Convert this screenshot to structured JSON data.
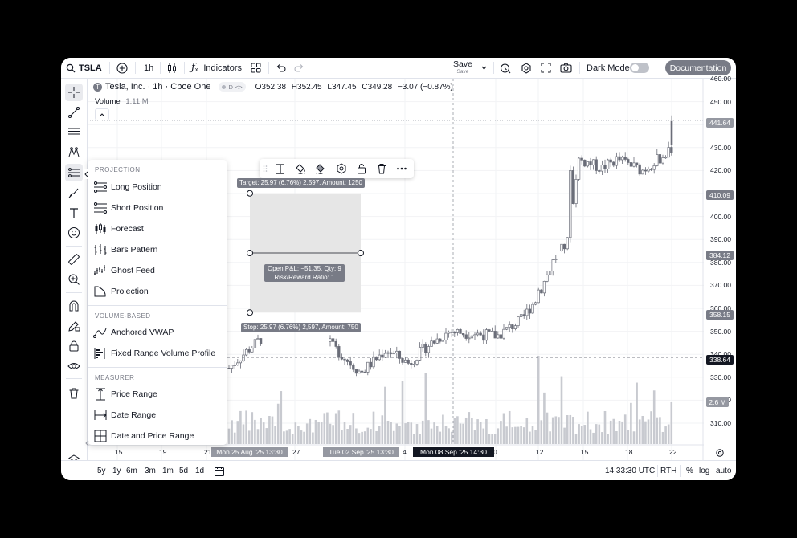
{
  "toolbar": {
    "symbol": "TSLA",
    "interval": "1h",
    "indicators_label": "Indicators",
    "save_label": "Save",
    "save_sub": "Save",
    "dark_mode_label": "Dark Mode",
    "dark_mode_on": false,
    "documentation_label": "Documentation"
  },
  "legend": {
    "title": "Tesla, Inc. · 1h · Cboe One",
    "badge": "D",
    "open_label": "O",
    "open": "352.38",
    "high_label": "H",
    "high": "352.45",
    "low_label": "L",
    "low": "347.45",
    "close_label": "C",
    "close": "349.28",
    "change": "−3.07 (−0.87%)",
    "volume_label": "Volume",
    "volume": "1.11 M"
  },
  "flyout": {
    "sections": [
      {
        "title": "PROJECTION",
        "items": [
          "Long Position",
          "Short Position",
          "Forecast",
          "Bars Pattern",
          "Ghost Feed",
          "Projection"
        ]
      },
      {
        "title": "VOLUME-BASED",
        "items": [
          "Anchored VWAP",
          "Fixed Range Volume Profile"
        ]
      },
      {
        "title": "MEASURER",
        "items": [
          "Price Range",
          "Date Range",
          "Date and Price Range"
        ]
      }
    ]
  },
  "position": {
    "target_label": "Target: 25.97 (6.76%) 2,597, Amount: 1250",
    "stop_label": "Stop: 25.97 (6.76%) 2,597, Amount: 750",
    "pnl_label": "Open P&L: −51.35, Qty: 9",
    "rr_label": "Risk/Reward Ratio: 1",
    "entry": 384.12,
    "target": 410.09,
    "stop": 358.15
  },
  "price_axis": {
    "ticks": [
      "460.00",
      "450.00",
      "440.00",
      "430.00",
      "420.00",
      "410.00",
      "400.00",
      "390.00",
      "380.00",
      "370.00",
      "360.00",
      "350.00",
      "340.00",
      "330.00",
      "320.00",
      "310.00"
    ],
    "labels": {
      "crosshair": "441.64",
      "target": "410.09",
      "entry": "384.12",
      "stop": "358.15",
      "last": "338.64",
      "volume": "2.6 M"
    }
  },
  "time_axis": {
    "ticks": [
      "15",
      "19",
      "21",
      "27",
      "4",
      "0",
      "12",
      "15",
      "18",
      "22"
    ],
    "range_start": "Mon 25 Aug '25   13:30",
    "range_end": "Tue 02 Sep '25   13:30",
    "crosshair": "Mon 08 Sep '25   14:30"
  },
  "bottom": {
    "ranges": [
      "5y",
      "1y",
      "6m",
      "3m",
      "1m",
      "5d",
      "1d"
    ],
    "clock": "14:33:30 UTC",
    "session": "RTH",
    "pct": "%",
    "log": "log",
    "auto": "auto"
  },
  "colors": {
    "accent": "#787b86",
    "candle": "#6a6d78",
    "volume": "#c8cad0",
    "zone": "#e6e6e6"
  }
}
